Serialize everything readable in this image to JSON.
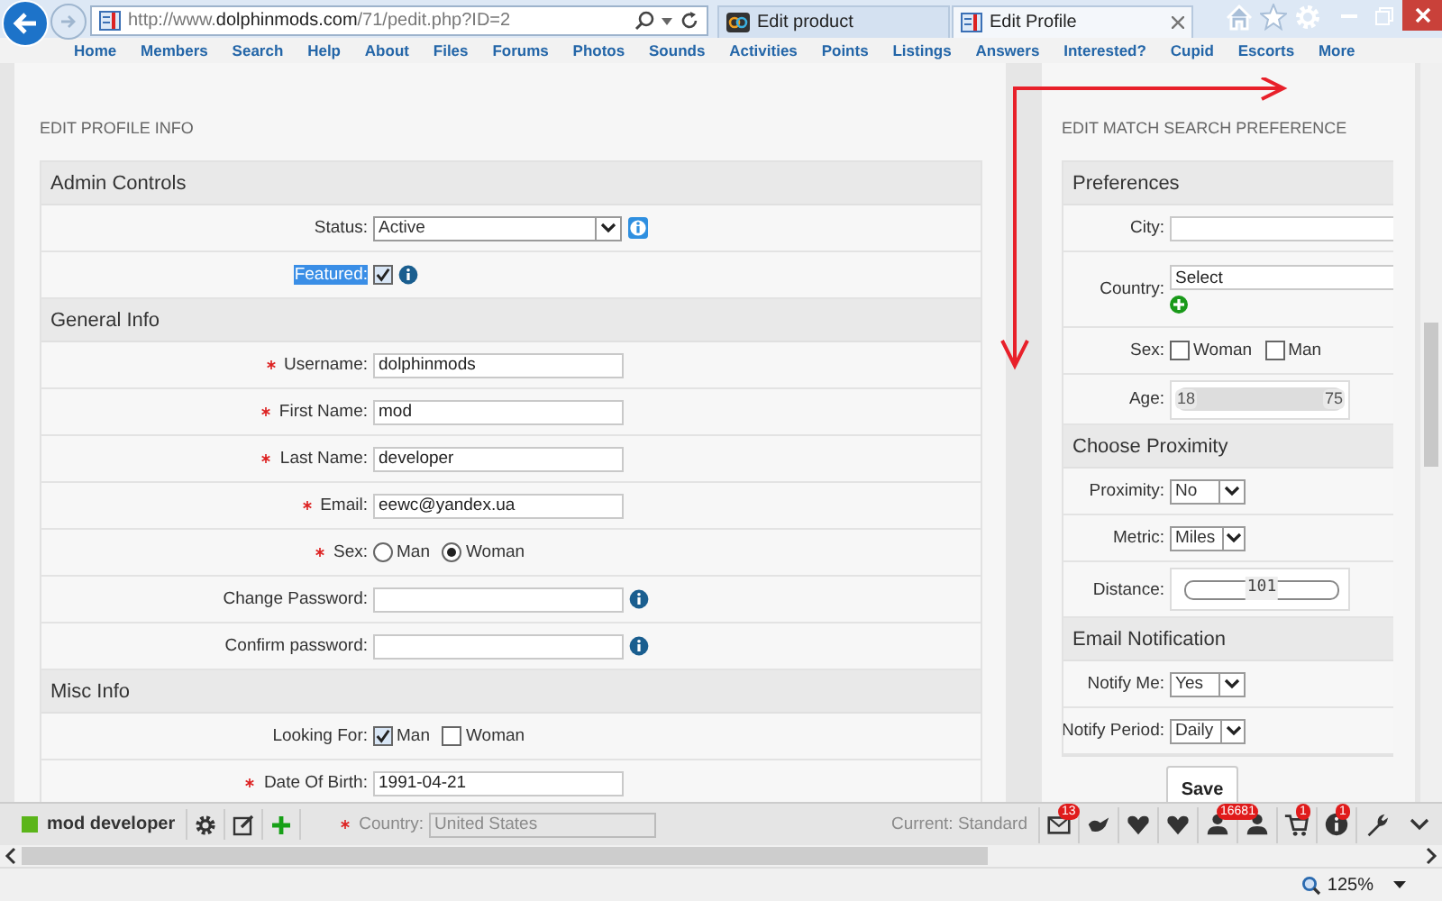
{
  "browser": {
    "url_host": "http://www.",
    "url_domain": "dolphinmods.com",
    "url_path": "/71/pedit.php?ID=2",
    "tabs": [
      {
        "title": "Edit product",
        "selected": false
      },
      {
        "title": "Edit Profile",
        "selected": true
      }
    ]
  },
  "nav": [
    "Home",
    "Members",
    "Search",
    "Help",
    "About",
    "Files",
    "Forums",
    "Photos",
    "Sounds",
    "Activities",
    "Points",
    "Listings",
    "Answers",
    "Interested?",
    "Cupid",
    "Escorts",
    "More"
  ],
  "profile": {
    "title": "EDIT PROFILE INFO",
    "sections": [
      {
        "title": "Admin Controls",
        "rows": [
          {
            "kind": "select",
            "label": "Status:",
            "required": false,
            "value": "Active",
            "info": true
          },
          {
            "kind": "checkbox",
            "label": "Featured:",
            "required": false,
            "highlighted": true,
            "checked": true,
            "info": true
          }
        ]
      },
      {
        "title": "General Info",
        "rows": [
          {
            "kind": "text",
            "label": "Username:",
            "required": true,
            "value": "dolphinmods"
          },
          {
            "kind": "text",
            "label": "First Name:",
            "required": true,
            "value": "mod"
          },
          {
            "kind": "text",
            "label": "Last Name:",
            "required": true,
            "value": "developer"
          },
          {
            "kind": "text",
            "label": "Email:",
            "required": true,
            "value": "eewc@yandex.ua"
          },
          {
            "kind": "radio",
            "label": "Sex:",
            "required": true,
            "options": [
              {
                "label": "Man",
                "selected": false
              },
              {
                "label": "Woman",
                "selected": true
              }
            ]
          },
          {
            "kind": "text",
            "label": "Change Password:",
            "required": false,
            "info": true
          },
          {
            "kind": "text",
            "label": "Confirm password:",
            "required": false,
            "info": true
          }
        ]
      },
      {
        "title": "Misc Info",
        "rows": [
          {
            "kind": "checks",
            "label": "Looking For:",
            "required": false,
            "options": [
              {
                "label": "Man",
                "checked": true
              },
              {
                "label": "Woman",
                "checked": false
              }
            ]
          },
          {
            "kind": "text",
            "label": "Date Of Birth:",
            "required": true,
            "value": "1991-04-21"
          }
        ]
      }
    ]
  },
  "match": {
    "title": "EDIT MATCH SEARCH PREFERENCE",
    "sections": [
      {
        "title": "Preferences",
        "rows": [
          {
            "kind": "text",
            "label": "City:"
          },
          {
            "kind": "text",
            "label": "Country:",
            "value": "Select",
            "add": true
          },
          {
            "kind": "checks",
            "label": "Sex:",
            "options": [
              {
                "label": "Woman",
                "checked": false
              },
              {
                "label": "Man",
                "checked": false
              }
            ]
          },
          {
            "kind": "range",
            "label": "Age:",
            "min": "18",
            "max": "75",
            "level": 1
          }
        ]
      },
      {
        "title": "Choose Proximity",
        "rows": [
          {
            "kind": "select",
            "label": "Proximity:",
            "value": "No"
          },
          {
            "kind": "select",
            "label": "Metric:",
            "value": "Miles"
          },
          {
            "kind": "slider",
            "label": "Distance:",
            "value": "101",
            "level": 0.5
          }
        ]
      },
      {
        "title": "Email Notification",
        "rows": [
          {
            "kind": "select",
            "label": "Notify Me:",
            "value": "Yes"
          },
          {
            "kind": "select",
            "label": "Notify Period:",
            "value": "Daily"
          }
        ]
      }
    ],
    "save": "Save"
  },
  "toolbar": {
    "user": "mod developer",
    "behind": {
      "required": true,
      "label": "Country:",
      "value": "United States",
      "note": "Current: Standard"
    },
    "items": [
      {
        "kind": "mail",
        "badge": "13"
      },
      {
        "kind": "bird"
      },
      {
        "kind": "heart"
      },
      {
        "kind": "heart"
      },
      {
        "kind": "person",
        "badge": "16681"
      },
      {
        "kind": "person"
      },
      {
        "kind": "cart",
        "badge": "1"
      },
      {
        "kind": "info",
        "badge": "1"
      },
      {
        "kind": "wrench"
      }
    ]
  },
  "status": {
    "zoom": "125%"
  }
}
